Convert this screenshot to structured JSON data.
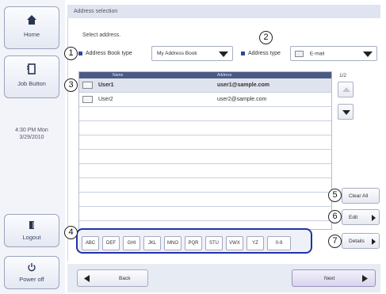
{
  "sidebar": {
    "home_label": "Home",
    "job_button_label": "Job Button",
    "clock_time": "4:30 PM  Mon",
    "clock_date": "3/29/2010",
    "logout_label": "Logout",
    "power_label": "Power off"
  },
  "header": {
    "title": "Address selection"
  },
  "main": {
    "prompt": "Select address.",
    "address_book_type_label": "Address Book type",
    "address_book_value": "My Address Book",
    "address_type_label": "Address type",
    "address_type_value": "E-mail",
    "columns": [
      "Name",
      "Address"
    ],
    "rows": [
      {
        "name": "User1",
        "address": "user1@sample.com",
        "selected": true
      },
      {
        "name": "User2",
        "address": "user2@sample.com",
        "selected": false
      }
    ],
    "page": "1/2"
  },
  "actions": {
    "clear_all": "Clear All",
    "edit": "Edit",
    "details": "Details"
  },
  "index_keys": [
    "ABC",
    "DEF",
    "GHI",
    "JKL",
    "MNO",
    "PQR",
    "STU",
    "VWX",
    "YZ",
    "0-9"
  ],
  "nav": {
    "back": "Back",
    "next": "Next"
  },
  "callouts": [
    "1",
    "2",
    "3",
    "4",
    "5",
    "6",
    "7"
  ],
  "colors": {
    "accent": "#2c4a9a",
    "highlight_border": "#2233a8",
    "header_bg": "#4a5a85"
  }
}
